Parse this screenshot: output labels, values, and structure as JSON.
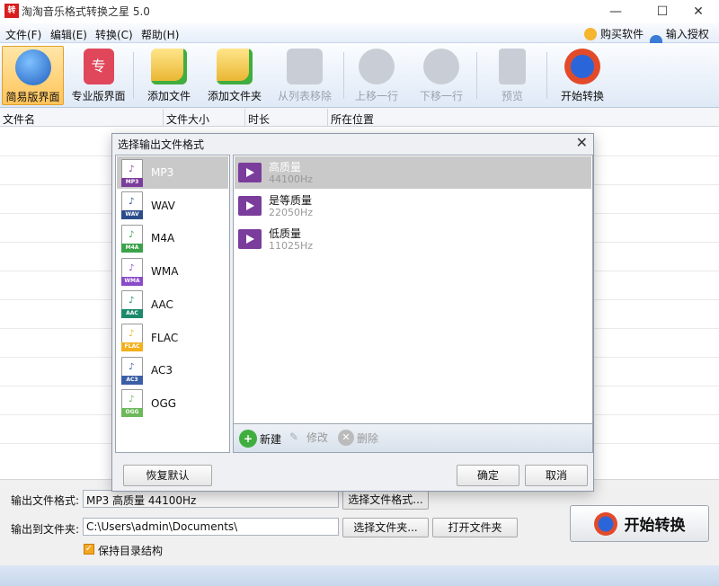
{
  "window": {
    "title": "淘淘音乐格式转换之星 5.0",
    "logo_text": "转",
    "minimize": "—",
    "maximize": "☐",
    "close": "✕"
  },
  "menu": {
    "items": [
      "文件(F)",
      "编辑(E)",
      "转换(C)",
      "帮助(H)"
    ],
    "buy": "购买软件",
    "license": "输入授权码"
  },
  "toolbar": {
    "simple": "简易版界面",
    "pro": "专业版界面",
    "pro_glyph": "专",
    "add_file": "添加文件",
    "add_folder": "添加文件夹",
    "remove": "从列表移除",
    "move_up": "上移一行",
    "move_down": "下移一行",
    "preview": "预览",
    "start": "开始转换"
  },
  "file_table": {
    "columns": [
      "文件名",
      "文件大小",
      "时长",
      "所在位置"
    ]
  },
  "dialog": {
    "title": "选择输出文件格式",
    "close": "✕",
    "formats": [
      {
        "name": "MP3",
        "tag": "MP3",
        "color": "#7b3d9c",
        "selected": true
      },
      {
        "name": "WAV",
        "tag": "WAV",
        "color": "#2b4d8c",
        "selected": false
      },
      {
        "name": "M4A",
        "tag": "M4A",
        "color": "#3aa34a",
        "selected": false
      },
      {
        "name": "WMA",
        "tag": "WMA",
        "color": "#8a4bc9",
        "selected": false
      },
      {
        "name": "AAC",
        "tag": "AAC",
        "color": "#1b8a6b",
        "selected": false
      },
      {
        "name": "FLAC",
        "tag": "FLAC",
        "color": "#f2b01e",
        "selected": false
      },
      {
        "name": "AC3",
        "tag": "AC3",
        "color": "#3b5fa6",
        "selected": false
      },
      {
        "name": "OGG",
        "tag": "OGG",
        "color": "#6cb85a",
        "selected": false
      }
    ],
    "qualities": [
      {
        "name": "高质量",
        "rate": "44100Hz",
        "selected": true
      },
      {
        "name": "是等质量",
        "rate": "22050Hz",
        "selected": false
      },
      {
        "name": "低质量",
        "rate": "11025Hz",
        "selected": false
      }
    ],
    "new_label": "新建",
    "edit_label": "修改",
    "delete_label": "删除",
    "restore_default": "恢复默认",
    "ok": "确定",
    "cancel": "取消"
  },
  "bottom": {
    "output_format_label": "输出文件格式:",
    "output_format_value": "MP3 高质量 44100Hz",
    "choose_format": "选择文件格式...",
    "output_folder_label": "输出到文件夹:",
    "output_folder_value": "C:\\Users\\admin\\Documents\\",
    "choose_folder": "选择文件夹...",
    "open_folder": "打开文件夹",
    "keep_structure": "保持目录结构",
    "keep_structure_checked": true,
    "start": "开始转换"
  }
}
